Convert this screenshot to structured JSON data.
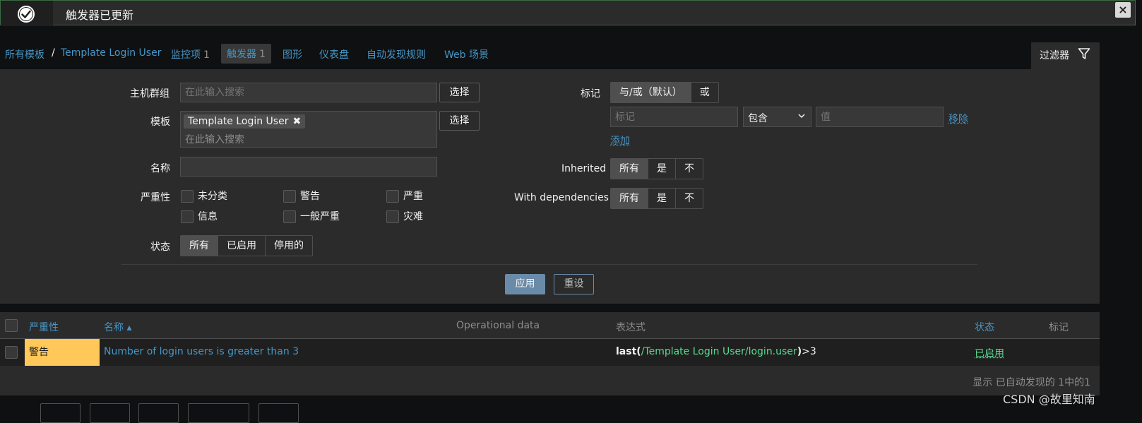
{
  "banner": {
    "message": "触发器已更新",
    "close": "×"
  },
  "breadcrumb": {
    "all_templates": "所有模板",
    "separator": "/",
    "template": "Template Login User"
  },
  "tabs": [
    {
      "label": "监控项",
      "count": "1"
    },
    {
      "label": "触发器",
      "count": "1"
    },
    {
      "label": "图形"
    },
    {
      "label": "仪表盘"
    },
    {
      "label": "自动发现规则"
    },
    {
      "label": "Web 场景"
    }
  ],
  "filter_tab": {
    "label": "过滤器"
  },
  "filter": {
    "host_group": {
      "label": "主机群组",
      "placeholder": "在此输入搜索",
      "select": "选择"
    },
    "template": {
      "label": "模板",
      "chip": "Template Login User",
      "chip_remove": "✖",
      "placeholder": "在此输入搜索",
      "select": "选择"
    },
    "name": {
      "label": "名称",
      "value": ""
    },
    "severity": {
      "label": "严重性",
      "options": [
        "未分类",
        "警告",
        "严重",
        "信息",
        "一般严重",
        "灾难"
      ]
    },
    "state": {
      "label": "状态",
      "options": [
        "所有",
        "已启用",
        "停用的"
      ],
      "selected": "所有"
    },
    "tags": {
      "label": "标记",
      "mode_options": [
        "与/或（默认）",
        "或"
      ],
      "tag_placeholder": "标记",
      "operator": "包含",
      "value_placeholder": "值",
      "remove": "移除",
      "add": "添加"
    },
    "inherited": {
      "label": "Inherited",
      "options": [
        "所有",
        "是",
        "不"
      ],
      "selected": "所有"
    },
    "with_dependencies": {
      "label": "With dependencies",
      "options": [
        "所有",
        "是",
        "不"
      ],
      "selected": "所有"
    },
    "apply": "应用",
    "reset": "重设"
  },
  "table": {
    "headers": {
      "severity": "严重性",
      "name": "名称 ▴",
      "operational_data": "Operational data",
      "expression": "表达式",
      "status": "状态",
      "tags": "标记"
    },
    "rows": [
      {
        "severity": "警告",
        "name": "Number of login users is greater than 3",
        "expr_func": "last",
        "expr_open": "(",
        "expr_item": "/Template Login User/login.user",
        "expr_close": ")",
        "expr_rest": ">3",
        "status": "已启用"
      }
    ],
    "footer": "显示 已自动发现的 1中的1"
  },
  "watermark": "CSDN @故里知南",
  "colors": {
    "accent_link": "#4796c4",
    "warning": "#ffc859",
    "enabled": "#59db8f",
    "panel": "#2b2b2b",
    "background": "#0e1012"
  }
}
